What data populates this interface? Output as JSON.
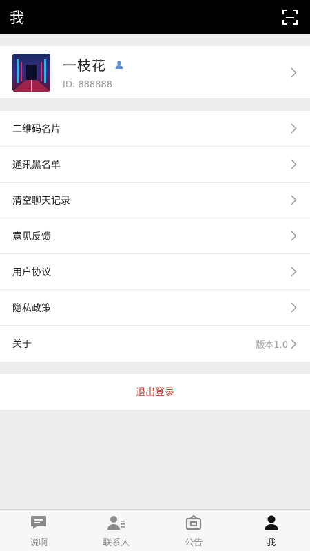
{
  "header": {
    "title": "我",
    "scan_icon": "scan-icon"
  },
  "profile": {
    "name": "一枝花",
    "id_text": "ID: 888888",
    "badge_icon": "user-badge-icon"
  },
  "menu": {
    "items": [
      {
        "label": "二维码名片",
        "value": ""
      },
      {
        "label": "通讯黑名单",
        "value": ""
      },
      {
        "label": "清空聊天记录",
        "value": ""
      },
      {
        "label": "意见反馈",
        "value": ""
      },
      {
        "label": "用户协议",
        "value": ""
      },
      {
        "label": "隐私政策",
        "value": ""
      },
      {
        "label": "关于",
        "value": "版本1.0"
      }
    ]
  },
  "logout": {
    "label": "退出登录"
  },
  "tabs": [
    {
      "label": "说啊",
      "icon": "chat-icon",
      "active": false
    },
    {
      "label": "联系人",
      "icon": "contacts-icon",
      "active": false
    },
    {
      "label": "公告",
      "icon": "announcement-icon",
      "active": false
    },
    {
      "label": "我",
      "icon": "me-icon",
      "active": true
    }
  ],
  "colors": {
    "header_bg": "#000000",
    "page_bg": "#ededed",
    "logout_text": "#c0392b",
    "badge": "#5b8fd6"
  }
}
